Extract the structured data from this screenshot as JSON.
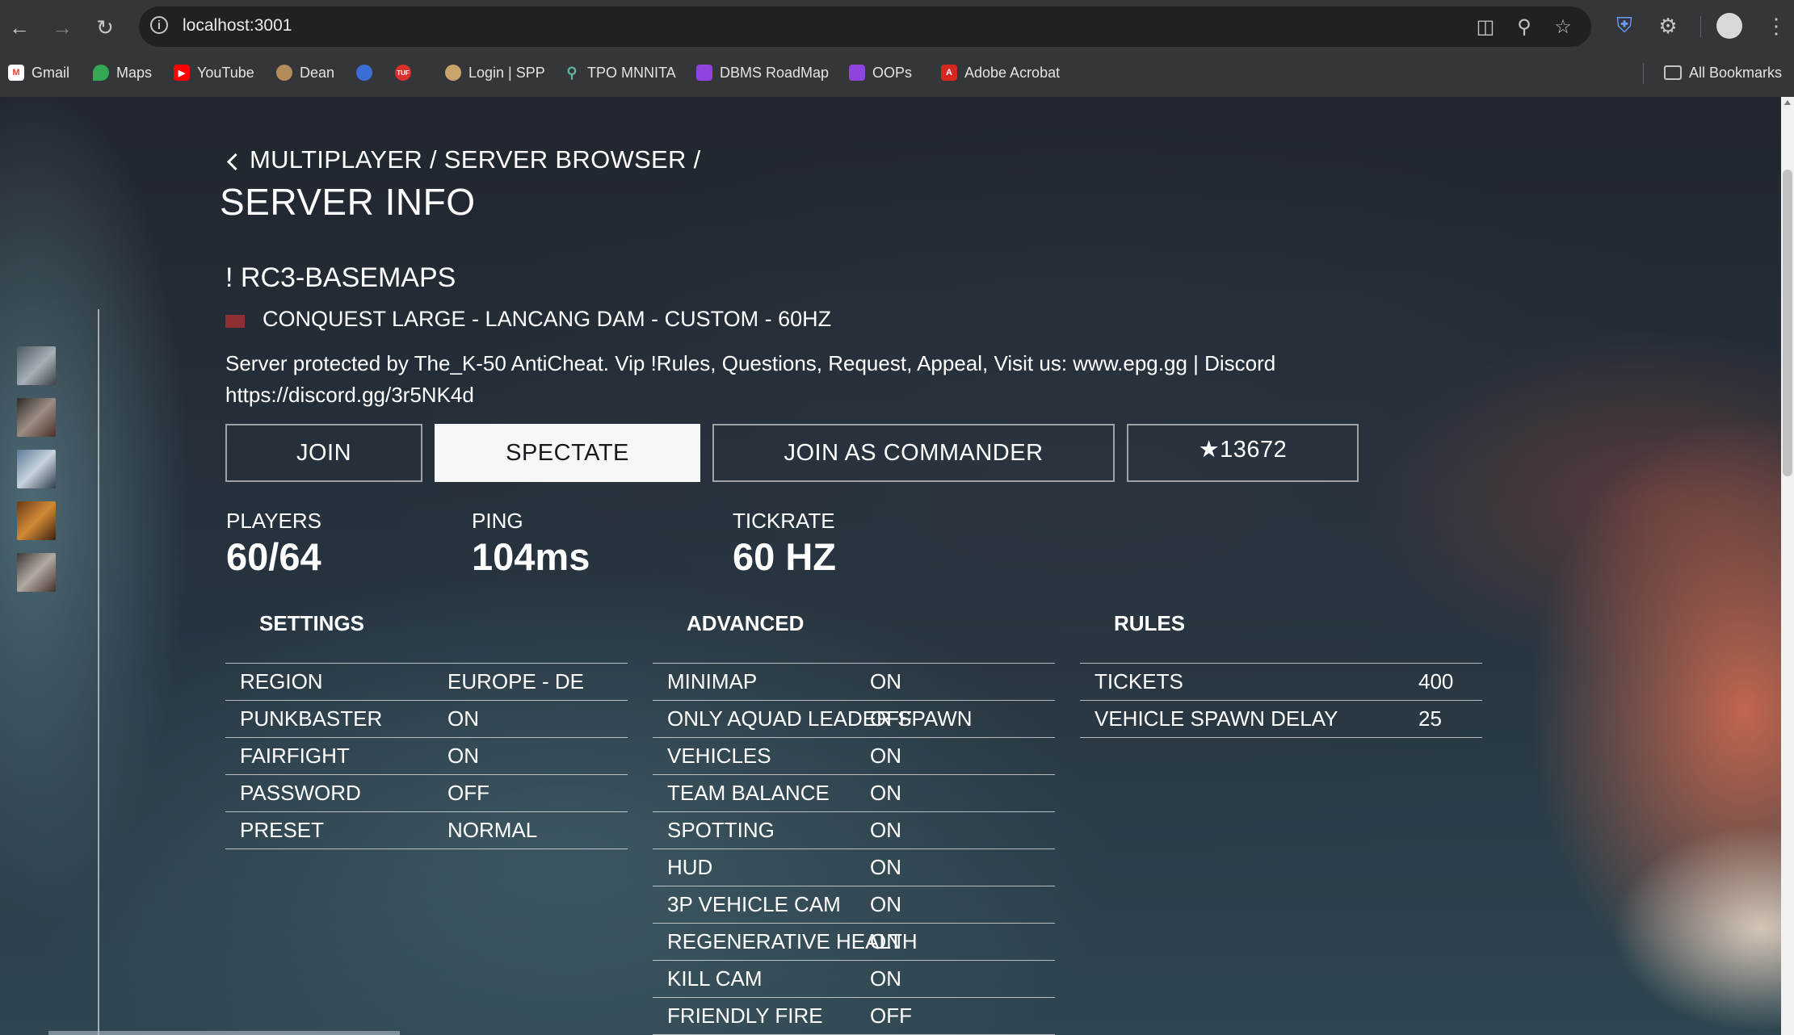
{
  "browser": {
    "url": "localhost:3001",
    "bookmarks": [
      {
        "label": "Gmail",
        "icon": "gmail-icon"
      },
      {
        "label": "Maps",
        "icon": "maps-icon"
      },
      {
        "label": "YouTube",
        "icon": "youtube-icon"
      },
      {
        "label": "Dean",
        "icon": "dean-icon"
      },
      {
        "label": "",
        "icon": "globe-blue-icon"
      },
      {
        "label": "",
        "icon": "tuf-icon"
      },
      {
        "label": "Login | SPP",
        "icon": "spp-icon"
      },
      {
        "label": "TPO MNNITA",
        "icon": "location-pin-icon"
      },
      {
        "label": "DBMS RoadMap",
        "icon": "twitch-icon"
      },
      {
        "label": "OOPs",
        "icon": "twitch-icon"
      },
      {
        "label": "Adobe Acrobat",
        "icon": "acrobat-icon"
      }
    ],
    "all_bookmarks_label": "All Bookmarks"
  },
  "page": {
    "breadcrumb": "MULTIPLAYER / SERVER BROWSER /",
    "title": "SERVER INFO",
    "server_name": "! RC3-BASEMAPS",
    "mode_line": "CONQUEST LARGE - LANCANG DAM - CUSTOM - 60HZ",
    "description": "Server protected by The_K-50 AntiCheat. Vip !Rules, Questions, Request, Appeal, Visit us: www.epg.gg | Discord https://discord.gg/3r5NK4d",
    "buttons": {
      "join": "JOIN",
      "spectate": "SPECTATE",
      "commander": "JOIN AS COMMANDER",
      "favorite": "★13672"
    },
    "stats": {
      "players_label": "PLAYERS",
      "players_value": "60/64",
      "ping_label": "PING",
      "ping_value": "104ms",
      "tickrate_label": "TICKRATE",
      "tickrate_value": "60 HZ"
    },
    "settings": {
      "heading": "SETTINGS",
      "rows": [
        {
          "key": "REGION",
          "value": "EUROPE - DE"
        },
        {
          "key": "PUNKBASTER",
          "value": "ON"
        },
        {
          "key": "FAIRFIGHT",
          "value": "ON"
        },
        {
          "key": "PASSWORD",
          "value": "OFF"
        },
        {
          "key": "PRESET",
          "value": "NORMAL"
        }
      ]
    },
    "advanced": {
      "heading": "ADVANCED",
      "rows": [
        {
          "key": "MINIMAP",
          "value": "ON"
        },
        {
          "key": "ONLY AQUAD LEADER SPAWN",
          "value": "OFF"
        },
        {
          "key": "VEHICLES",
          "value": "ON"
        },
        {
          "key": "TEAM BALANCE",
          "value": "ON"
        },
        {
          "key": "SPOTTING",
          "value": "ON"
        },
        {
          "key": "HUD",
          "value": "ON"
        },
        {
          "key": "3P VEHICLE CAM",
          "value": "ON"
        },
        {
          "key": "REGENERATIVE HEALTH",
          "value": "ON"
        },
        {
          "key": "KILL CAM",
          "value": "ON"
        },
        {
          "key": "FRIENDLY FIRE",
          "value": "OFF"
        }
      ]
    },
    "rules": {
      "heading": "RULES",
      "rows": [
        {
          "key": "TICKETS",
          "value": "400"
        },
        {
          "key": "VEHICLE SPAWN DELAY",
          "value": "25"
        }
      ]
    }
  }
}
